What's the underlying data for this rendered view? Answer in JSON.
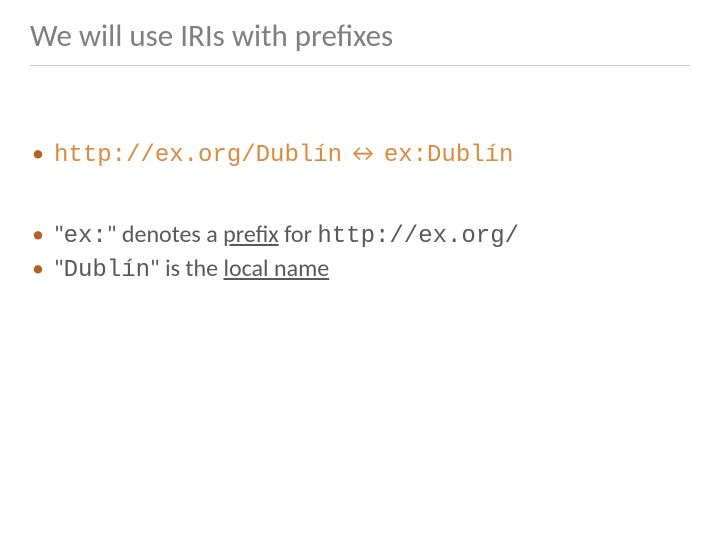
{
  "title": "We will use IRIs with prefixes",
  "bullet1": {
    "full_iri": "http://ex.org/Dublín",
    "arrow": " ↔ ",
    "prefixed": "ex:Dublín"
  },
  "bullet2": {
    "open_quote": "\"",
    "prefix_code": "ex:",
    "close_quote_denotes": "\" denotes a ",
    "prefix_word": "prefix",
    "for_text": " for ",
    "base_iri": "http://ex.org/"
  },
  "bullet3": {
    "open_quote": "\"",
    "local_code": "Dublín",
    "close_quote_is": "\" is the ",
    "local_name": "local name"
  }
}
